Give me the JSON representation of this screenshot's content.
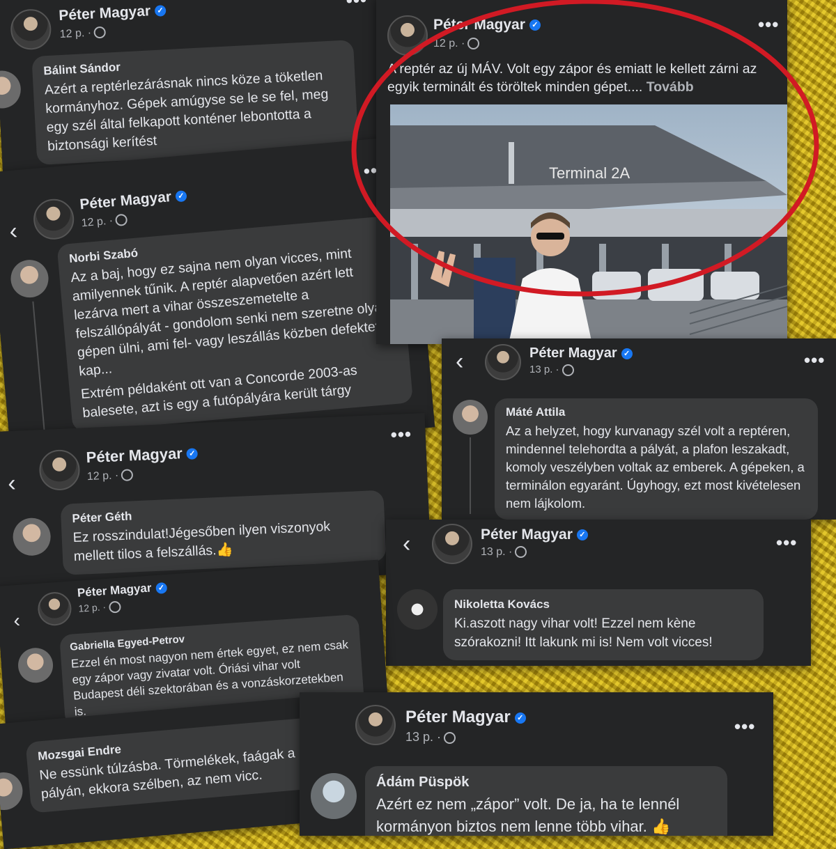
{
  "colors": {
    "card_bg": "#242526",
    "bubble_bg": "#3a3b3c",
    "text": "#e4e6eb",
    "muted": "#b0b3b8",
    "verified_blue": "#1877f2",
    "highlight_circle": "#d11a24",
    "background": "#c9a814"
  },
  "icons": {
    "verified": "✓",
    "more": "•••",
    "back": "‹",
    "globe": "globe-icon",
    "thumbs_up": "👍"
  },
  "author": "Péter Magyar",
  "time_12": "12 p. ·",
  "time_13": "13 p. ·",
  "post": {
    "text": "A reptér az új MÁV. Volt egy zápor és emiatt le kellett zárni az egyik terminált és töröltek minden gépet....",
    "more_label": "Tovább",
    "photo_sign": "Terminal 2A"
  },
  "comments": {
    "balint": {
      "name": "Bálint Sándor",
      "text": "Azért a reptérlezárásnak nincs köze a töketlen kormányhoz. Gépek amúgyse se le se fel, meg egy szél által felkapott konténer lebontotta a biztonsági kerítést"
    },
    "norbi": {
      "name": "Norbi Szabó",
      "text": "Az a baj, hogy ez sajna nem olyan vicces, mint amilyennek tűnik. A reptér alapvetően azért lett lezárva mert a vihar összeszemetelte a felszállópályát - gondolom senki nem szeretne olyan gépen ülni, ami fel- vagy leszállás közben defektet kap...",
      "text2": "Extrém példaként ott van a Concorde 2003-as balesete, azt is egy a futópályára került tárgy"
    },
    "mate": {
      "name": "Máté Attila",
      "text": "Az a helyzet, hogy kurvanagy szél volt a reptéren, mindennel telehordta a pályát, a plafon leszakadt, komoly veszélyben voltak az emberek. A gépeken, a terminálon egyaránt. Úgyhogy, ezt most kivételesen nem lájkolom."
    },
    "geth": {
      "name": "Péter Géth",
      "text": "Ez rosszindulat!Jégesőben ilyen viszonyok mellett tilos a felszállás."
    },
    "nikoletta": {
      "name": "Nikoletta Kovács",
      "text": "Ki.aszott nagy vihar volt! Ezzel nem kène szórakozni! Itt lakunk mi is! Nem volt vicces!"
    },
    "gabriella": {
      "name": "Gabriella Egyed-Petrov",
      "text": "Ezzel én most nagyon nem értek egyet, ez nem csak egy zápor vagy zivatar volt. Óriási vihar volt Budapest déli szektorában és a vonzáskorzetekben is."
    },
    "mozsgai": {
      "name": "Mozsgai Endre",
      "text": "Ne essünk túlzásba. Törmelékek, faágak a pályán, ekkora szélben, az nem vicc."
    },
    "adam": {
      "name": "Ádám Püspök",
      "text": "Azért ez nem „zápor” volt. De ja, ha te lennél kormányon biztos nem lenne több vihar."
    }
  }
}
